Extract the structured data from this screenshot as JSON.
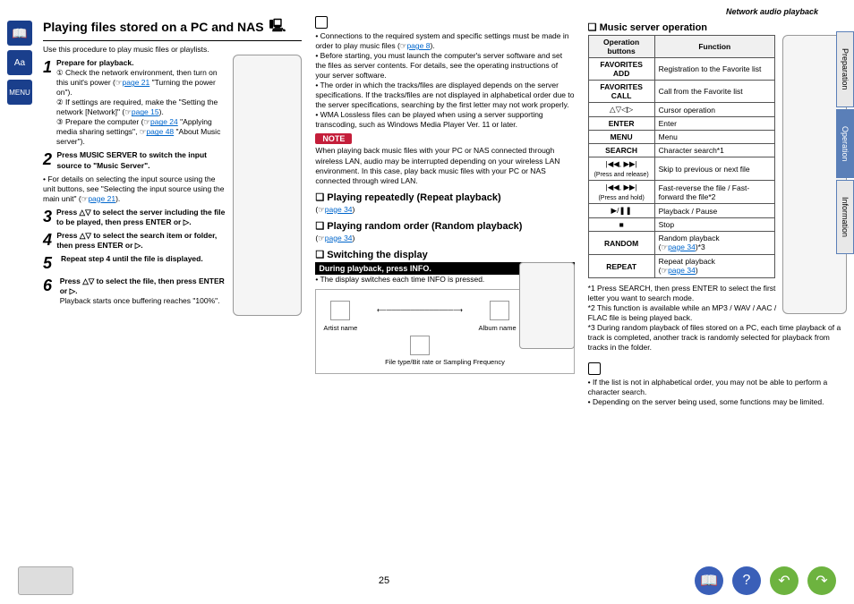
{
  "header": "Network audio playback",
  "title": "Playing files stored on a PC and NAS",
  "intro": "Use this procedure to play music files or playlists.",
  "step1_title": "Prepare for playback.",
  "s1a": "① Check the network environment, then turn on this unit's power (",
  "s1a_link": "page 21",
  "s1a2": " \"Turning the power on\").",
  "s1b": "② If settings are required, make the \"Setting the network [Network]\" (",
  "s1b_link": "page 15",
  "s1b2": ").",
  "s1c": "③ Prepare the computer (",
  "s1c_link": "page 24",
  "s1c2": " \"Applying media sharing settings\", ",
  "s1c_link2": "page 48",
  "s1c3": " \"About Music server\").",
  "step2": "Press MUSIC SERVER to switch the input source to \"Music Server\".",
  "step2_note": "• For details on selecting the input source using the unit buttons, see \"Selecting the input source using the main unit\" (",
  "step2_link": "page 21",
  "step2_note2": ").",
  "step3": "Press △▽ to select the server including the file to be played, then press ENTER or ▷.",
  "step4": "Press △▽ to select the search item or folder, then press ENTER or ▷.",
  "step5": "Repeat step 4 until the file is displayed.",
  "step6": "Press △▽ to select the file, then press ENTER or ▷.",
  "step6b": "Playback starts once buffering reaches \"100%\".",
  "b1": "Connections to the required system and specific settings must be made in order to play music files (",
  "b1_link": "page 8",
  "b1b": ").",
  "b2": "Before starting, you must launch the computer's server software and set the files as server contents. For details, see the operating instructions of your server software.",
  "b3": "The order in which the tracks/files are displayed depends on the server specifications. If the tracks/files are not displayed in alphabetical order due to the server specifications, searching by the first letter may not work properly.",
  "b4": "WMA Lossless files can be played when using a server supporting transcoding, such as Windows Media Player Ver. 11 or later.",
  "note_label": "NOTE",
  "note_text": "When playing back music files with your PC or NAS connected through wireless LAN, audio may be interrupted depending on your wireless LAN environment. In this case, play back music files with your PC or NAS connected through wired LAN.",
  "repeat_title": "Playing repeatedly (Repeat playback)",
  "repeat_link": "page 34",
  "random_title": "Playing random order (Random playback)",
  "random_link": "page 34",
  "switch_title": "Switching the display",
  "switch_bar": "During playback, press INFO.",
  "switch_text": "The display switches each time INFO is pressed.",
  "d_artist": "Artist name",
  "d_album": "Album name",
  "d_file": "File type/Bit rate or Sampling Frequency",
  "music_title": "Music server operation",
  "th1": "Operation buttons",
  "th2": "Function",
  "r1a": "FAVORITES ADD",
  "r1b": "Registration to the Favorite list",
  "r2a": "FAVORITES CALL",
  "r2b": "Call from the Favorite list",
  "r3a": "△▽◁▷",
  "r3b": "Cursor operation",
  "r4a": "ENTER",
  "r4b": "Enter",
  "r5a": "MENU",
  "r5b": "Menu",
  "r6a": "SEARCH",
  "r6b": "Character search*1",
  "r7a": "|◀◀, ▶▶|",
  "r7a2": "(Press and release)",
  "r7b": "Skip to previous or next file",
  "r8a": "|◀◀, ▶▶|",
  "r8a2": "(Press and hold)",
  "r8b": "Fast-reverse the file / Fast-forward the file*2",
  "r9a": "▶/❚❚",
  "r9b": "Playback / Pause",
  "r10a": "■",
  "r10b": "Stop",
  "r11a": "RANDOM",
  "r11b": "Random playback",
  "r11link": "page 34",
  "r11b2": "*3",
  "r12a": "REPEAT",
  "r12b": "Repeat playback",
  "r12link": "page 34",
  "fn1": "*1 Press SEARCH, then press ENTER to select the first letter you want to search mode.",
  "fn2": "*2 This function is available while an MP3 / WAV / AAC / FLAC file is being played back.",
  "fn3": "*3 During random playback of files stored on a PC, each time playback of a track is completed, another track is randomly selected for playback from tracks in the folder.",
  "end1": "If the list is not in alphabetical order, you may not be able to perform a character search.",
  "end2": "Depending on the server being used, some functions may be limited.",
  "tab1": "Preparation",
  "tab2": "Operation",
  "tab3": "Information",
  "pagenum": "25"
}
